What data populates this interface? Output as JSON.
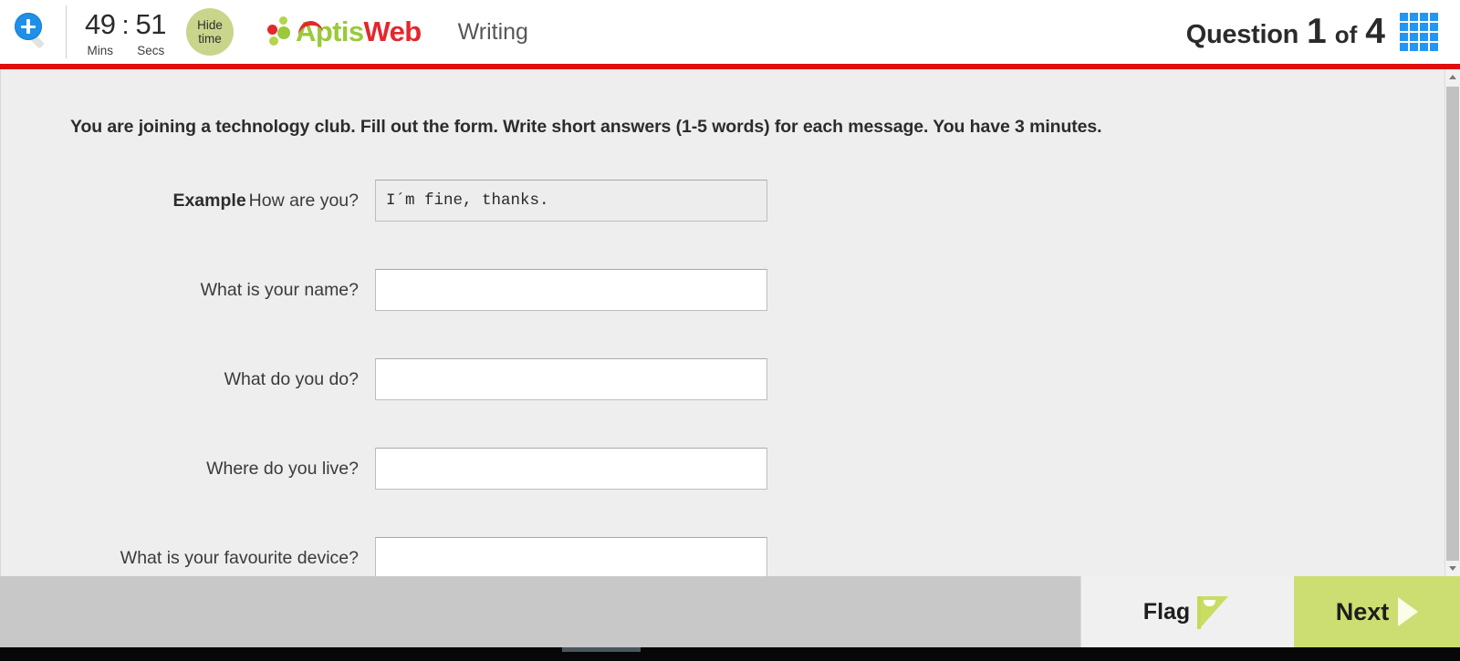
{
  "header": {
    "zoom_icon": "magnifier-plus-icon",
    "timer": {
      "minutes": "49",
      "colon": ":",
      "seconds": "51",
      "minutes_label": "Mins",
      "seconds_label": "Secs"
    },
    "hide_time": {
      "line1": "Hide",
      "line2": "time"
    },
    "logo": {
      "part1": "Aptis",
      "part2": "Web"
    },
    "section": "Writing",
    "question_counter": {
      "label": "Question",
      "current": "1",
      "of": "of",
      "total": "4"
    },
    "grid_icon": "grid-menu-icon"
  },
  "main": {
    "instructions": "You are joining a technology club. Fill out the form. Write short answers (1-5 words) for each message. You have 3 minutes.",
    "rows": [
      {
        "tag": "Example",
        "question": "How are you?",
        "answer": "I´m fine, thanks.",
        "readonly": true
      },
      {
        "tag": "",
        "question": "What is your name?",
        "answer": "",
        "readonly": false
      },
      {
        "tag": "",
        "question": "What do you do?",
        "answer": "",
        "readonly": false
      },
      {
        "tag": "",
        "question": "Where do you live?",
        "answer": "",
        "readonly": false
      },
      {
        "tag": "",
        "question": "What is your favourite device?",
        "answer": "",
        "readonly": false
      }
    ]
  },
  "footer": {
    "flag_label": "Flag",
    "flag_icon": "flag-icon",
    "next_label": "Next",
    "next_icon": "chevron-right-icon"
  },
  "colors": {
    "accent_red": "#e00d0d",
    "accent_green": "#ccde72",
    "logo_green": "#9ac93a",
    "logo_red": "#e2282c",
    "hide_time_green": "#c9d58b",
    "grid_blue": "#2196f3"
  }
}
